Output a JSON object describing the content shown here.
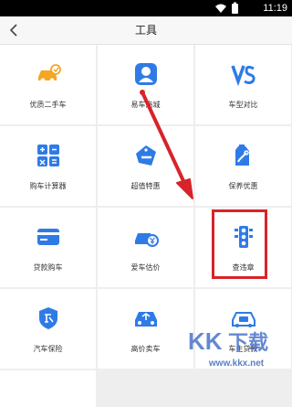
{
  "status_bar": {
    "time": "11:19"
  },
  "header": {
    "title": "工具"
  },
  "tools": [
    {
      "label": "优质二手车",
      "icon": "used-car-icon",
      "color": "#f5a623"
    },
    {
      "label": "易车商城",
      "icon": "user-icon",
      "color": "#2f7be6"
    },
    {
      "label": "车型对比",
      "icon": "vs-icon",
      "color": "#2f7be6"
    },
    {
      "label": "购车计算器",
      "icon": "calculator-icon",
      "color": "#2f7be6"
    },
    {
      "label": "超值特惠",
      "icon": "sale-tag-icon",
      "color": "#2f7be6"
    },
    {
      "label": "保养优惠",
      "icon": "maintenance-icon",
      "color": "#2f7be6"
    },
    {
      "label": "贷款购车",
      "icon": "credit-card-icon",
      "color": "#2f7be6"
    },
    {
      "label": "爱车估价",
      "icon": "car-valuation-icon",
      "color": "#2f7be6"
    },
    {
      "label": "查违章",
      "icon": "traffic-light-icon",
      "color": "#2f7be6"
    },
    {
      "label": "汽车保险",
      "icon": "insurance-shield-icon",
      "color": "#2f7be6"
    },
    {
      "label": "高价卖车",
      "icon": "sell-car-icon",
      "color": "#2f7be6"
    },
    {
      "label": "车主贷款",
      "icon": "owner-loan-icon",
      "color": "#2f7be6"
    }
  ],
  "annotation": {
    "accent": "#d8232a"
  },
  "watermark": {
    "text": "www.kkx.net"
  }
}
